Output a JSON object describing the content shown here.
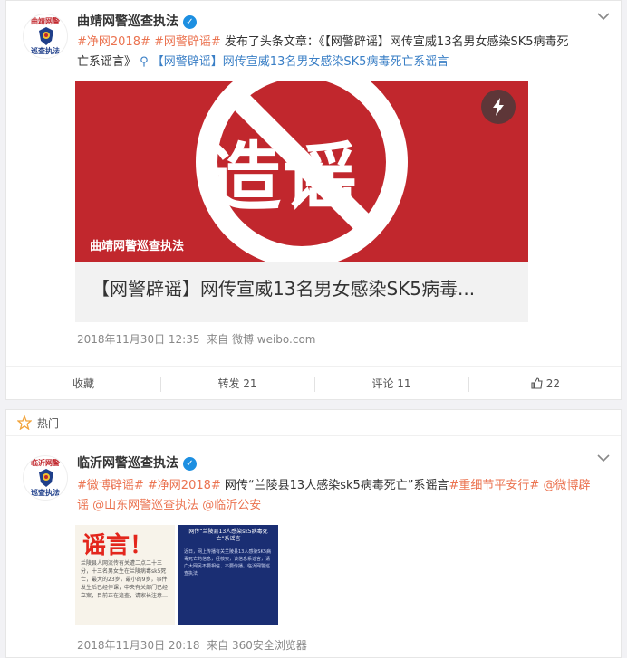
{
  "post1": {
    "author": "曲靖网警巡查执法",
    "verified_icon": "check-icon",
    "line1_prefix": "#净网2018# #网警辟谣#",
    "line1_rest": " 发布了头条文章：《【网警辟谣】网传宣威13名男女感染SK5病毒死",
    "line2_text": "亡系谣言》 ",
    "line2_link": "【网警辟谣】网传宣威13名男女感染SK5病毒死亡系谣言",
    "avatar_top": "曲靖网警",
    "avatar_bottom": "巡查执法",
    "image": {
      "big_text": "造谣",
      "watermark": "曲靖网警巡查执法",
      "lightning_icon": "lightning-icon",
      "caption": "【网警辟谣】网传宣威13名男女感染SK5病毒..."
    },
    "time": "2018年11月30日 12:35",
    "source": "来自 微博 weibo.com",
    "actions": {
      "collect": "收藏",
      "repost": "转发 21",
      "comment": "评论 11",
      "like": "22"
    }
  },
  "hot": {
    "label": "热门"
  },
  "post2": {
    "author": "临沂网警巡查执法",
    "avatar_top": "临沂网警",
    "avatar_bottom": "巡查执法",
    "line1_links": "#微博辟谣# #净网2018#",
    "line1_text": " 网传“兰陵县13人感染sk5病毒死亡”系谣言",
    "line1_link2": "#重细节平安行#",
    "line1_link3": " @微博辟",
    "line2_text": "谣 @山东网警巡查执法 @临沂公安",
    "img1_title": "谣言！",
    "img1_body": "兰陵县人网流传有关遭二点二十三分，十三名男女生在兰陵病毒sk5死亡，最大的23岁，最小的9岁，事件发生后已经停课，中央有关部门已经立案，目前正在追查，请家长注意…",
    "img2_title": "网传“兰陵县13人感染sk5病毒死亡”系谣言",
    "img2_body": "近日，网上传播有关兰陵县13人感染SK5病毒死亡的信息，经核实，该信息系谣言，请广大网民不要相信、不要传播。临沂网警巡查执法",
    "time": "2018年11月30日 20:18",
    "source": "来自 360安全浏览器"
  },
  "colors": {
    "accent": "#eb7350",
    "link_blue": "#3a7fc6",
    "banner_red": "#c1272d",
    "verified": "#1d8fe1"
  }
}
